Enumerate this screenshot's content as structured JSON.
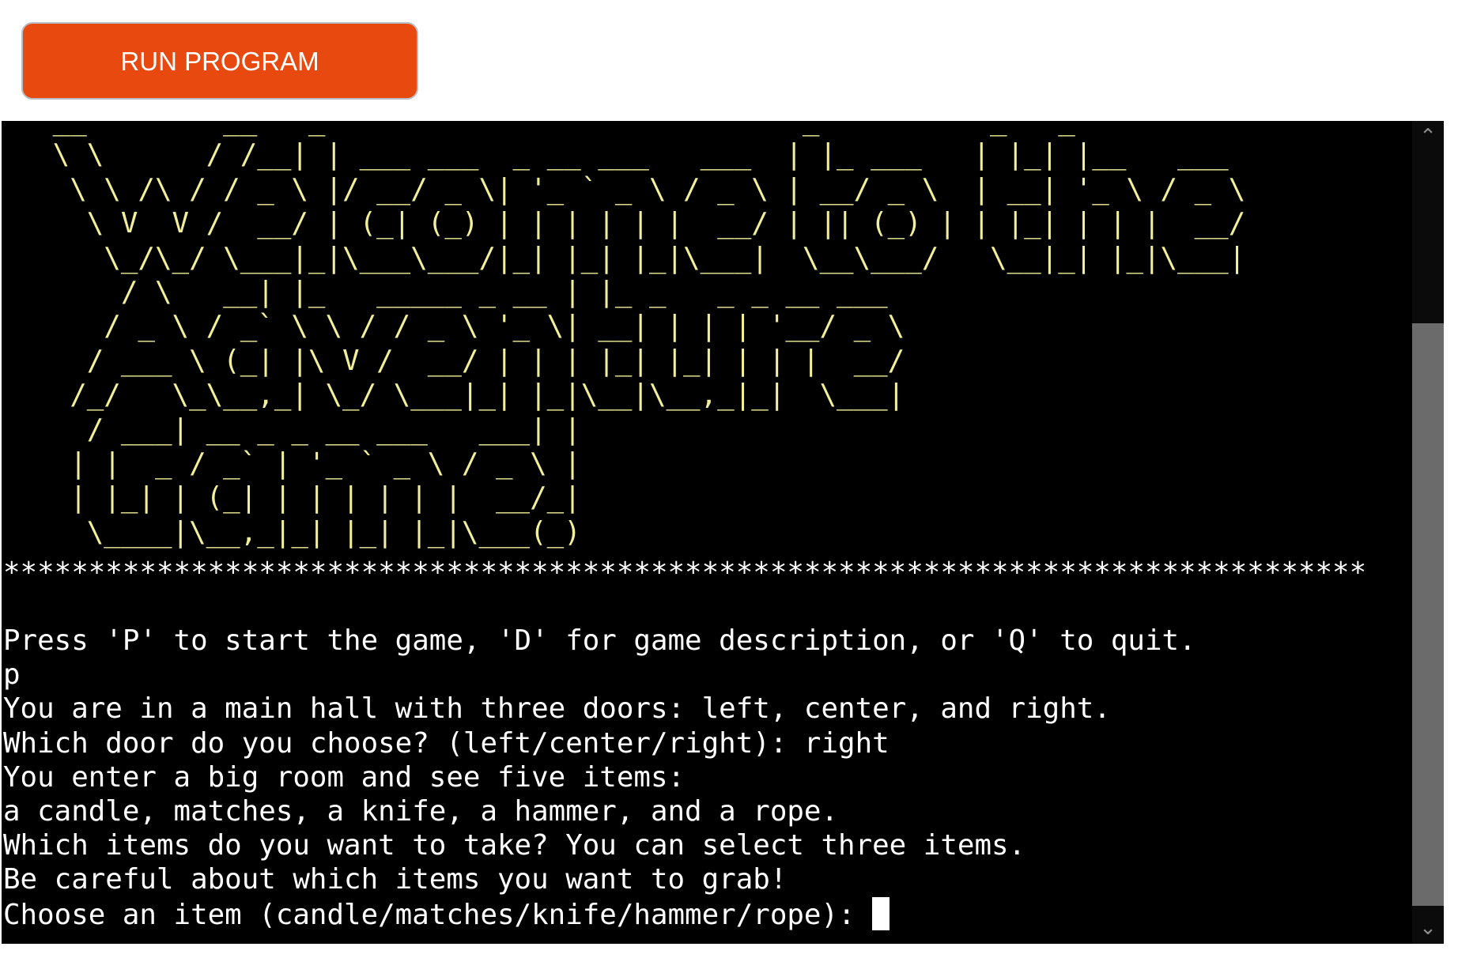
{
  "toolbar": {
    "run_label": "RUN PROGRAM",
    "run_color": "#e8490f"
  },
  "terminal": {
    "background": "#000000",
    "logo_color": "#f2ef9a",
    "ascii_logo": "   __        __   _                            _          _   _\n   \\ \\      / /__| | ___ ___  _ __ ___   ___  | |_ ___   | |_| |__   ___\n    \\ \\ /\\ / / _ \\ |/ __/ _ \\| '_ ` _ \\ / _ \\ | __/ _ \\  | __| '_ \\ / _ \\\n     \\ V  V /  __/ | (_| (_) | | | | | |  __/ | || (_) | | |_| | | |  __/\n      \\_/\\_/ \\___|_|\\___\\___/|_| |_| |_|\\___|  \\__\\___/   \\__|_| |_|\\___|\n       / \\   __| |_   _____ _ __ | |_ _   _ _ __ ___\n      / _ \\ / _` \\ \\ / / _ \\ '_ \\| __| | | | '__/ _ \\\n     / ___ \\ (_| |\\ V /  __/ | | | |_| |_| | | |  __/\n    /_/   \\_\\__,_| \\_/ \\___|_| |_|\\__|\\__,_|_|  \\___|\n     / ___| __ _ _ __ ___   ___| |\n    | |  _ / _` | '_ ` _ \\ / _ \\ |\n    | |_| | (_| | | | | | |  __/_|\n     \\____|\\__,_|_| |_| |_|\\___(_)",
    "separator": "********************************************************************************",
    "lines": [
      "Press 'P' to start the game, 'D' for game description, or 'Q' to quit.",
      "p",
      "You are in a main hall with three doors: left, center, and right.",
      "Which door do you choose? (left/center/right): right",
      "You enter a big room and see five items:",
      "a candle, matches, a knife, a hammer, and a rope.",
      "Which items do you want to take? You can select three items.",
      "Be careful about which items you want to grab!",
      "Choose an item (candle/matches/knife/hammer/rope): "
    ]
  },
  "scrollbar": {
    "up_icon": "chevron-up-icon",
    "down_icon": "chevron-down-icon"
  }
}
